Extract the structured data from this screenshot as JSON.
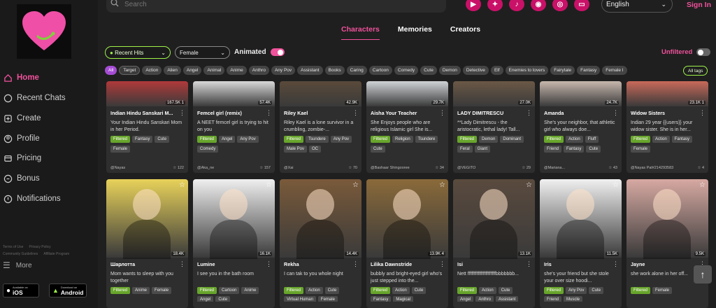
{
  "search": {
    "placeholder": "Search"
  },
  "language": {
    "selected": "English"
  },
  "signin_label": "Sign In",
  "nav": [
    {
      "label": "Home",
      "icon": "home-icon",
      "active": true
    },
    {
      "label": "Recent Chats",
      "icon": "chat-icon"
    },
    {
      "label": "Create",
      "icon": "create-icon"
    },
    {
      "label": "Profile",
      "icon": "profile-icon"
    },
    {
      "label": "Pricing",
      "icon": "pricing-icon"
    },
    {
      "label": "Bonus",
      "icon": "bonus-icon"
    },
    {
      "label": "Notifications",
      "icon": "bell-icon"
    }
  ],
  "side_links": [
    "Terms of Use",
    "Privacy Policy",
    "Community Guidelines",
    "Affiliate Program"
  ],
  "more_label": "More",
  "stores": {
    "ios": {
      "small": "Available on",
      "big": "iOS"
    },
    "android": {
      "small": "Download on",
      "big": "Android"
    }
  },
  "tabs": [
    "Characters",
    "Memories",
    "Creators"
  ],
  "filters": {
    "sort": "Recent Hits",
    "gender": "Female",
    "animated_label": "Animated",
    "unfiltered_label": "Unfiltered"
  },
  "tags": [
    "All",
    "Target",
    "Action",
    "Alien",
    "Angel",
    "Animal",
    "Anime",
    "Anthro",
    "Any Pov",
    "Assistant",
    "Books",
    "Caring",
    "Cartoon",
    "Comedy",
    "Cute",
    "Demon",
    "Detective",
    "Elf",
    "Enemies to lovers",
    "Fairytale",
    "Fantasy",
    "Female I"
  ],
  "all_tags_label": "All tags",
  "row1": [
    {
      "name": "Indian Hindu Sanskari M...",
      "stats": "167.5K  1",
      "desc": "Your Indian Hindu Sanskari Mom in her Period.",
      "tags": [
        "Filtered",
        "Fantasy",
        "Cute",
        "Female"
      ],
      "author": "@Nayas",
      "likes": "122",
      "color": "#b0393a"
    },
    {
      "name": "Femcel girl (remix)",
      "stats": "57.4K",
      "desc": "A NEET femcel girl is trying to hit on you",
      "tags": [
        "Filtered",
        "Angel",
        "Any Pov",
        "Comedy"
      ],
      "author": "@Aka_ne",
      "likes": "157",
      "color": "#d9d9d9"
    },
    {
      "name": "Riley Kael",
      "stats": "42.9K",
      "desc": "Riley Kael is a lone survivor in a crumbling, zombie-...",
      "tags": [
        "Filtered",
        "Tsundere",
        "Any Pov",
        "Male Pov",
        "OC"
      ],
      "author": "@Xai",
      "likes": "70",
      "color": "#5a4a3a"
    },
    {
      "name": "Aisha Your Teacher",
      "stats": "29.7K",
      "desc": "She Enjoys people who are religious Islamic girl She is...",
      "tags": [
        "Filtered",
        "Religion",
        "Tsundere",
        "Cute"
      ],
      "author": "@Bashaar Shingooree",
      "likes": "34",
      "color": "#cfd3d6"
    },
    {
      "name": "LADY DIMITRESCU",
      "stats": "27.0K",
      "desc": "**Lady Dimitrescu - the aristocratic, lethal lady! Tall...",
      "tags": [
        "Filtered",
        "Demon",
        "Dominant",
        "Feral",
        "Giant"
      ],
      "author": "@VEGITO",
      "likes": "29",
      "color": "#6b5846"
    },
    {
      "name": "Amanda",
      "stats": "24.7K",
      "desc": "She's your neighbor, that athletic girl who always doe...",
      "tags": [
        "Filtered",
        "Action",
        "Fluff",
        "Friend",
        "Fantasy",
        "Cute"
      ],
      "author": "@Mariana...",
      "likes": "43",
      "color": "#c7b7ad"
    },
    {
      "name": "Widow Sisters",
      "stats": "23.1K  1",
      "desc": "Indian 29 year {{users}} your widow sister. She is in her...",
      "tags": [
        "Filtered",
        "Action",
        "Fantasy",
        "Female"
      ],
      "author": "@Nayas Pal#214293583",
      "likes": "4",
      "color": "#c96a5a"
    }
  ],
  "row2": [
    {
      "name": "Шарлотта",
      "stats": "18.4K",
      "desc": "Mom wants to sleep with you together",
      "tags": [
        "Filtered",
        "Anime",
        "Female"
      ],
      "color": "#e8d25a"
    },
    {
      "name": "Lumine",
      "stats": "16.1K",
      "desc": "I see you in the bath room",
      "tags": [
        "Filtered",
        "Cartoon",
        "Anime",
        "Angel",
        "Cute"
      ],
      "color": "#efefef"
    },
    {
      "name": "Rekha",
      "stats": "14.4K",
      "desc": "I can tak to you whole night",
      "tags": [
        "Filtered",
        "Action",
        "Cute",
        "Virtual Human",
        "Female"
      ],
      "color": "#7a5a3a"
    },
    {
      "name": "Lilika Dawnstride",
      "stats": "13.9K  4",
      "desc": "bubbly and bright-eyed girl who's just stepped into the...",
      "tags": [
        "Filtered",
        "Action",
        "Cute",
        "Fantasy",
        "Magical"
      ],
      "color": "#8a6a3a"
    },
    {
      "name": "Isi",
      "stats": "13.1K",
      "desc": "Nett ffffffffffffffffffffffbbbbbbb...",
      "tags": [
        "Filtered",
        "Action",
        "Cute",
        "Angel",
        "Anthro",
        "Assistant"
      ],
      "color": "#5a4a3e"
    },
    {
      "name": "Iris",
      "stats": "11.5K",
      "desc": "she's your friend but she stole your over size hoodi...",
      "tags": [
        "Filtered",
        "Any Pov",
        "Cute",
        "Friend",
        "Muscle"
      ],
      "color": "#f0f0f0"
    },
    {
      "name": "Jayne",
      "stats": "9.5K",
      "desc": "she work alone in her off...",
      "tags": [
        "Filtered",
        "Female"
      ],
      "color": "#d7a9a2"
    }
  ]
}
